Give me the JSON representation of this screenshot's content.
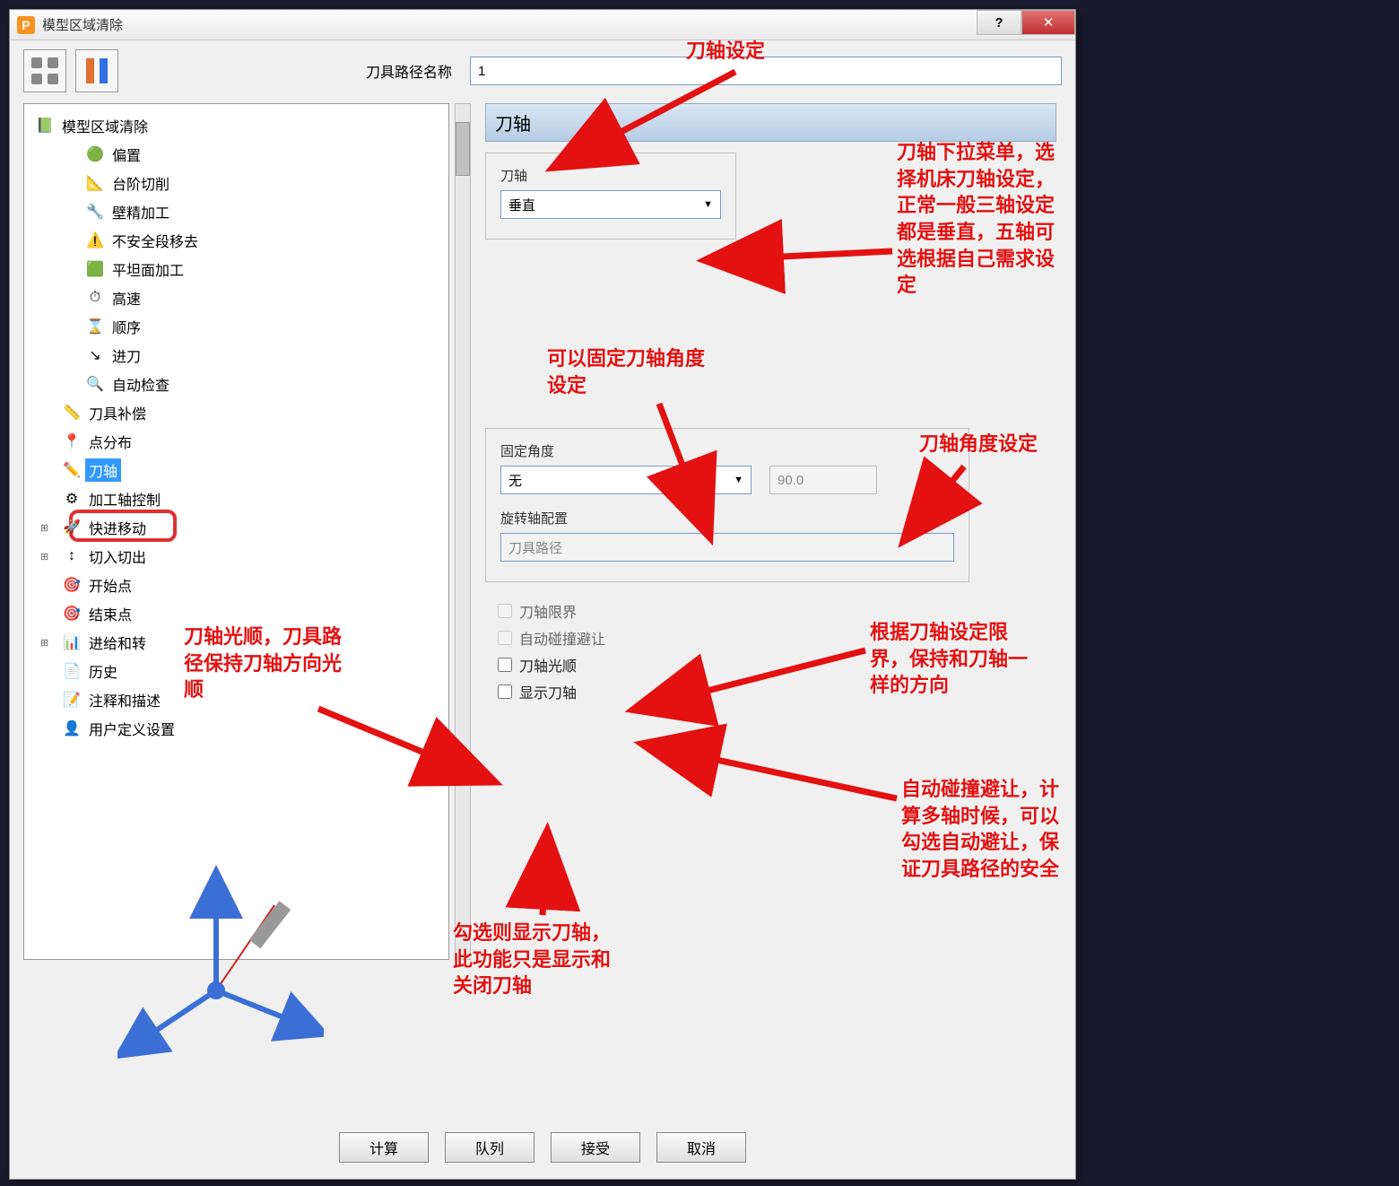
{
  "window": {
    "title": "模型区域清除",
    "app_icon_letter": "P",
    "help_glyph": "?",
    "close_glyph": "✕"
  },
  "header": {
    "name_label": "刀具路径名称",
    "name_value": "1"
  },
  "tree": {
    "root": "模型区域清除",
    "items": [
      {
        "icon": "🟢",
        "label": "偏置"
      },
      {
        "icon": "📐",
        "label": "台阶切削"
      },
      {
        "icon": "🔧",
        "label": "壁精加工"
      },
      {
        "icon": "⚠️",
        "label": "不安全段移去"
      },
      {
        "icon": "🟩",
        "label": "平坦面加工"
      },
      {
        "icon": "⏱",
        "label": "高速"
      },
      {
        "icon": "⌛",
        "label": "顺序"
      },
      {
        "icon": "↘",
        "label": "进刀"
      },
      {
        "icon": "🔍",
        "label": "自动检查"
      }
    ],
    "siblings": [
      {
        "icon": "📏",
        "label": "刀具补偿"
      },
      {
        "icon": "📍",
        "label": "点分布"
      },
      {
        "icon": "✏️",
        "label": "刀轴",
        "selected": true
      },
      {
        "icon": "⚙",
        "label": "加工轴控制"
      },
      {
        "icon": "🚀",
        "label": "快进移动",
        "expandable": true
      },
      {
        "icon": "↕",
        "label": "切入切出",
        "expandable": true
      },
      {
        "icon": "🎯",
        "label": "开始点"
      },
      {
        "icon": "🎯",
        "label": "结束点"
      },
      {
        "icon": "📊",
        "label": "进给和转",
        "expandable": true
      },
      {
        "icon": "📄",
        "label": "历史"
      },
      {
        "icon": "📝",
        "label": "注释和描述"
      },
      {
        "icon": "👤",
        "label": "用户定义设置"
      }
    ]
  },
  "panel": {
    "section_title": "刀轴",
    "axis_label": "刀轴",
    "axis_value": "垂直",
    "fixed_angle_label": "固定角度",
    "fixed_angle_value": "无",
    "angle_value": "90.0",
    "rot_config_label": "旋转轴配置",
    "rot_config_value": "刀具路径",
    "chk_limit": "刀轴限界",
    "chk_collision": "自动碰撞避让",
    "chk_smooth": "刀轴光顺",
    "chk_show": "显示刀轴"
  },
  "buttons": {
    "calc": "计算",
    "queue": "队列",
    "accept": "接受",
    "cancel": "取消"
  },
  "annotations": {
    "a1": "刀轴设定",
    "a2": "刀轴下拉菜单，选\n择机床刀轴设定，\n正常一般三轴设定\n都是垂直，五轴可\n选根据自己需求设\n定",
    "a3": "可以固定刀轴角度\n设定",
    "a4": "刀轴角度设定",
    "a5": "根据刀轴设定限\n界，保持和刀轴一\n样的方向",
    "a6": "自动碰撞避让，计\n算多轴时候，可以\n勾选自动避让，保\n证刀具路径的安全",
    "a7": "刀轴光顺，刀具路\n径保持刀轴方向光\n顺",
    "a8": "勾选则显示刀轴，\n此功能只是显示和\n关闭刀轴"
  }
}
